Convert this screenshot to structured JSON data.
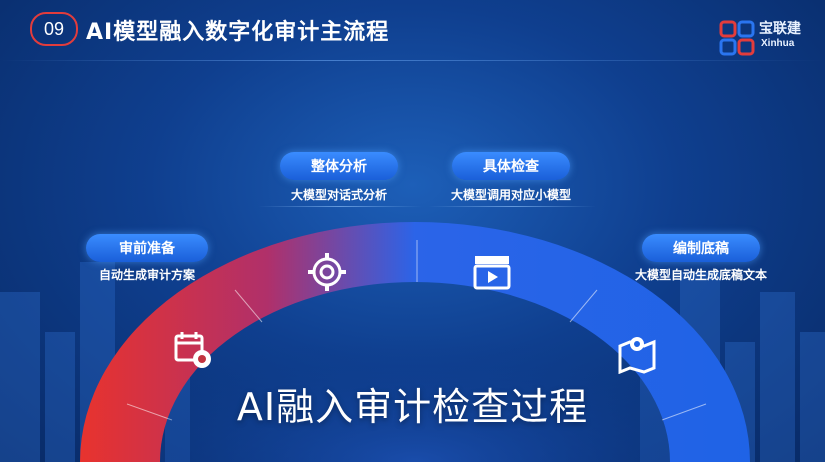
{
  "header": {
    "number": "09",
    "title": "AI模型融入数字化审计主流程"
  },
  "logo": {
    "brand": "宝联建",
    "sub": "Xinhua"
  },
  "steps": [
    {
      "label": "审前准备",
      "desc": "自动生成审计方案",
      "icon": "calendar-gear-icon"
    },
    {
      "label": "整体分析",
      "desc": "大模型对话式分析",
      "icon": "gear-target-icon"
    },
    {
      "label": "具体检查",
      "desc": "大模型调用对应小模型",
      "icon": "clapper-play-icon"
    },
    {
      "label": "编制底稿",
      "desc": "大模型自动生成底稿文本",
      "icon": "map-pin-icon"
    }
  ],
  "main_title": "AI融入审计检查过程",
  "colors": {
    "accent_red": "#e23c3c",
    "pill_blue": "#2a75f0",
    "arc_red": "#e8332e",
    "arc_blue": "#1f63e6"
  }
}
